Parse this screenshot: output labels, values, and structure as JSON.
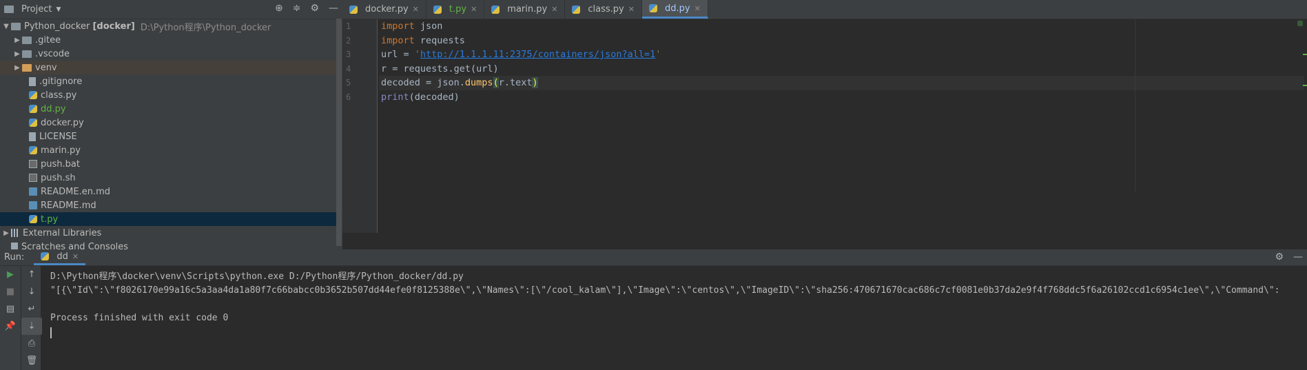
{
  "project_panel": {
    "title": "Project",
    "tree": [
      {
        "label": "Python_docker",
        "bold_suffix": "[docker]",
        "path": "D:\\Python程序\\Python_docker",
        "type": "root"
      },
      {
        "label": ".gitee",
        "type": "folder"
      },
      {
        "label": ".vscode",
        "type": "folder"
      },
      {
        "label": "venv",
        "type": "folder-orange"
      },
      {
        "label": ".gitignore",
        "type": "file"
      },
      {
        "label": "class.py",
        "type": "py"
      },
      {
        "label": "dd.py",
        "type": "py-green"
      },
      {
        "label": "docker.py",
        "type": "py"
      },
      {
        "label": "LICENSE",
        "type": "file"
      },
      {
        "label": "marin.py",
        "type": "py"
      },
      {
        "label": "push.bat",
        "type": "sh"
      },
      {
        "label": "push.sh",
        "type": "sh"
      },
      {
        "label": "README.en.md",
        "type": "md"
      },
      {
        "label": "README.md",
        "type": "md"
      },
      {
        "label": "t.py",
        "type": "py-green"
      },
      {
        "label": "External Libraries",
        "type": "lib"
      },
      {
        "label": "Scratches and Consoles",
        "type": "scratch"
      }
    ]
  },
  "tabs": [
    {
      "label": "docker.py",
      "active": false
    },
    {
      "label": "t.py",
      "active": false
    },
    {
      "label": "marin.py",
      "active": false
    },
    {
      "label": "class.py",
      "active": false
    },
    {
      "label": "dd.py",
      "active": true
    }
  ],
  "editor": {
    "line_numbers": [
      "1",
      "2",
      "3",
      "4",
      "5",
      "6"
    ],
    "lines": {
      "l1_kw": "import",
      "l1_rest": " json",
      "l2_kw": "import",
      "l2_rest": " requests",
      "l3_a": "url = ",
      "l3_str": "'http://1.1.1.11:2375/containers/json?all=1'",
      "l4": "r = requests.get(url)",
      "l5_a": "decoded = json.",
      "l5_fn": "dumps",
      "l5_p1": "(",
      "l5_b": "r.text",
      "l5_p2": ")",
      "l6_bi": "print",
      "l6_rest": "(decoded)"
    }
  },
  "run_panel": {
    "label": "Run:",
    "tab": "dd",
    "console": [
      "D:\\Python程序\\docker\\venv\\Scripts\\python.exe D:/Python程序/Python_docker/dd.py",
      "\"[{\\\"Id\\\":\\\"f8026170e99a16c5a3aa4da1a80f7c66babcc0b3652b507dd44efe0f8125388e\\\",\\\"Names\\\":[\\\"/cool_kalam\\\"],\\\"Image\\\":\\\"centos\\\",\\\"ImageID\\\":\\\"sha256:470671670cac686c7cf0081e0b37da2e9f4f768ddc5f6a26102ccd1c6954c1ee\\\",\\\"Command\\\":",
      "",
      "Process finished with exit code 0"
    ]
  }
}
